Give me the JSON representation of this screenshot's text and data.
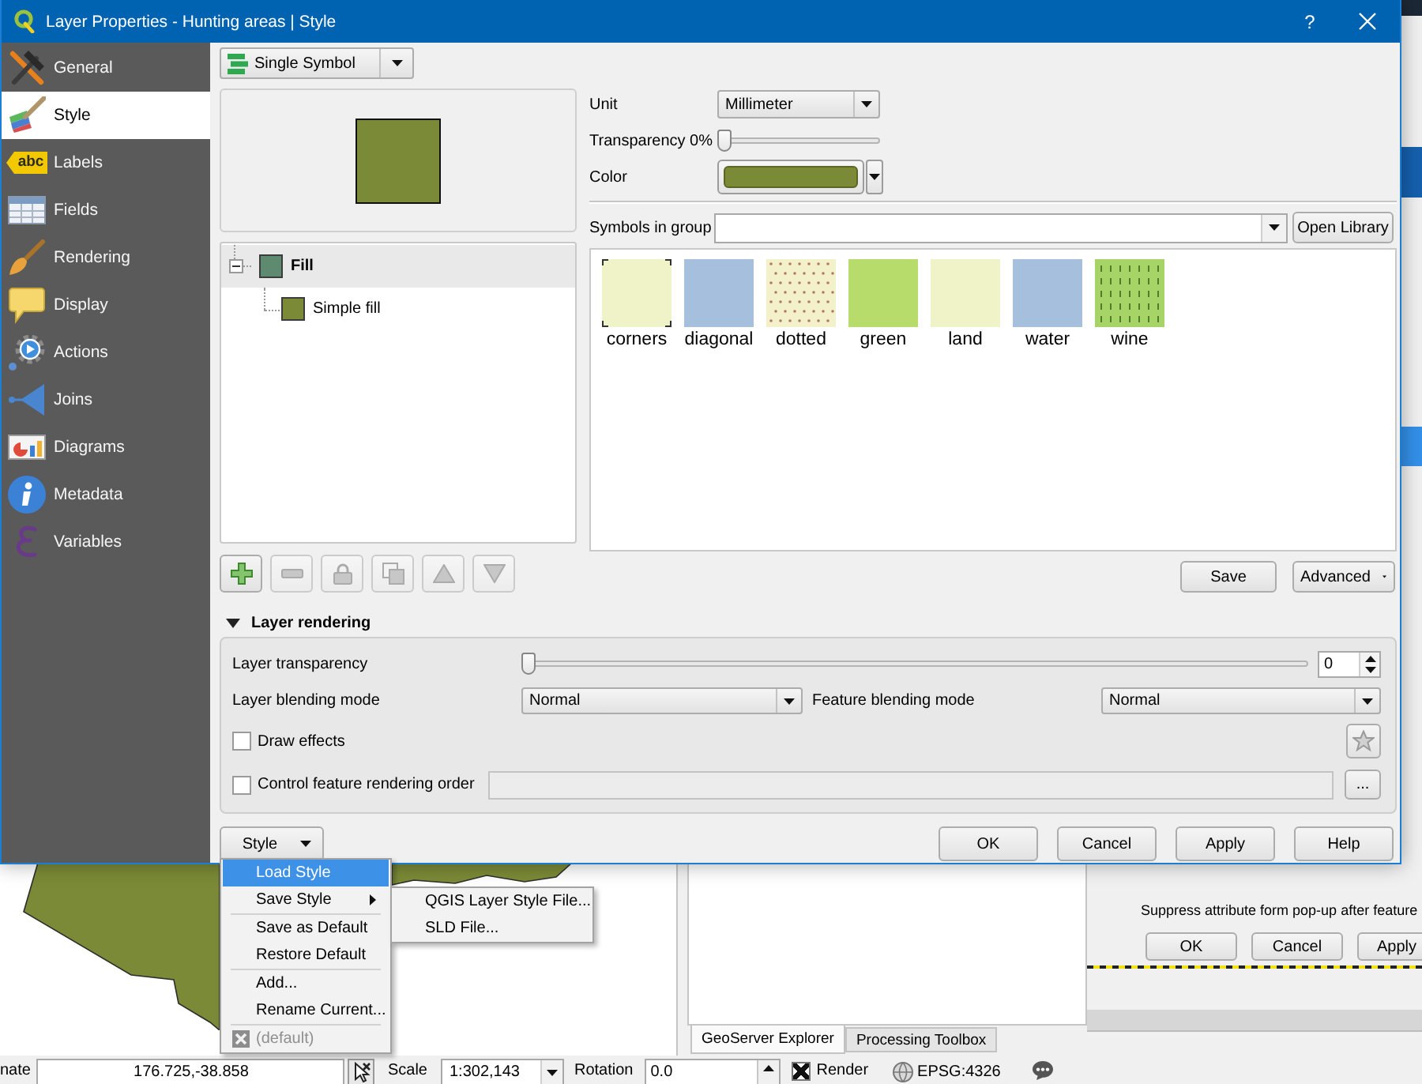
{
  "window": {
    "title": "Layer Properties - Hunting areas | Style",
    "help": "?"
  },
  "sidebar": {
    "items": [
      {
        "label": "General",
        "kind": "tools",
        "selected": false
      },
      {
        "label": "Style",
        "kind": "palette",
        "selected": true
      },
      {
        "label": "Labels",
        "kind": "tag",
        "tag_text": "abc",
        "selected": false
      },
      {
        "label": "Fields",
        "kind": "table",
        "selected": false
      },
      {
        "label": "Rendering",
        "kind": "paintbrush",
        "selected": false
      },
      {
        "label": "Display",
        "kind": "bubble",
        "selected": false
      },
      {
        "label": "Actions",
        "kind": "gear",
        "selected": false
      },
      {
        "label": "Joins",
        "kind": "cone",
        "selected": false
      },
      {
        "label": "Diagrams",
        "kind": "chart",
        "selected": false
      },
      {
        "label": "Metadata",
        "kind": "info",
        "selected": false
      },
      {
        "label": "Variables",
        "kind": "epsilon",
        "selected": false
      }
    ]
  },
  "renderer": {
    "value": "Single Symbol"
  },
  "symbol_layers": [
    {
      "label": "Fill",
      "color": "#5e8a70",
      "selected": true,
      "expanded": true,
      "children": [
        {
          "label": "Simple fill",
          "color": "#7b8a36",
          "selected": false
        }
      ]
    }
  ],
  "layer_buttons": [
    {
      "kind": "add",
      "disabled": false
    },
    {
      "kind": "remove",
      "disabled": true
    },
    {
      "kind": "lock",
      "disabled": true
    },
    {
      "kind": "duplicate",
      "disabled": true
    },
    {
      "kind": "up",
      "disabled": true
    },
    {
      "kind": "down",
      "disabled": true
    }
  ],
  "symbol_settings": {
    "unit_label": "Unit",
    "unit": "Millimeter",
    "transparency": {
      "label": "Transparency 0%",
      "level": 0
    },
    "color_label": "Color",
    "color": "#7b8a36"
  },
  "symbols_in_group": {
    "label": "Symbols in group",
    "open_library": "Open Library",
    "items": [
      {
        "label": "corners",
        "kind": "corners",
        "color": "#eff3c7",
        "selected": false
      },
      {
        "label": "diagonal",
        "kind": "plain",
        "color": "#a5bfdd",
        "selected": false
      },
      {
        "label": "dotted",
        "kind": "dotted",
        "color": "#f2f1c9",
        "selected": false
      },
      {
        "label": "green",
        "kind": "plain",
        "color": "#b7dc6b",
        "selected": false
      },
      {
        "label": "land",
        "kind": "plain",
        "color": "#eff3c7",
        "selected": false
      },
      {
        "label": "water",
        "kind": "plain",
        "color": "#a5bfdd",
        "selected": false
      },
      {
        "label": "wine",
        "kind": "dashed",
        "color": "#a6d466",
        "selected": false
      }
    ]
  },
  "symbol_actions": {
    "save": "Save",
    "advanced": "Advanced"
  },
  "layer_rendering": {
    "title": "Layer rendering",
    "expanded": true,
    "transparency": {
      "label": "Layer transparency",
      "level": 0,
      "value": "0"
    },
    "layer_blending_label": "Layer blending mode",
    "layer_blending": "Normal",
    "feature_blending_label": "Feature blending mode",
    "feature_blending": "Normal",
    "draw_effects": {
      "label": "Draw effects",
      "checked": false
    },
    "rendering_order": {
      "label": "Control feature rendering order",
      "checked": false
    },
    "order_button": "..."
  },
  "footer": {
    "style_button": "Style",
    "buttons": [
      "OK",
      "Cancel",
      "Apply",
      "Help"
    ]
  },
  "style_menu": {
    "groups": [
      [
        {
          "label": "Load Style",
          "kind": "action",
          "selected": true,
          "disabled": false
        },
        {
          "label": "Save Style",
          "kind": "submenu",
          "selected": false,
          "disabled": false
        }
      ],
      [
        {
          "label": "Save as Default",
          "kind": "action",
          "selected": false,
          "disabled": false
        },
        {
          "label": "Restore Default",
          "kind": "action",
          "selected": false,
          "disabled": false
        }
      ],
      [
        {
          "label": "Add...",
          "kind": "action",
          "selected": false,
          "disabled": false
        },
        {
          "label": "Rename Current...",
          "kind": "action",
          "selected": false,
          "disabled": false
        }
      ],
      [
        {
          "label": "(default)",
          "kind": "style",
          "selected": false,
          "disabled": true
        }
      ]
    ]
  },
  "save_style_submenu": {
    "items": [
      {
        "label": "QGIS Layer Style File...",
        "selected": false
      },
      {
        "label": "SLD File...",
        "selected": false
      }
    ]
  },
  "dock_tabs": [
    {
      "label": "GeoServer Explorer",
      "selected": true
    },
    {
      "label": "Processing Toolbox",
      "selected": false
    }
  ],
  "digitizing": {
    "text": "Suppress attribute form pop-up after feature",
    "buttons": [
      "OK",
      "Cancel",
      "Apply"
    ]
  },
  "status_bar": {
    "coordinate_label": "nate",
    "coordinate": "176.725,-38.858",
    "scale_label": "Scale",
    "scale": "1:302,143",
    "rotation_label": "Rotation",
    "rotation": "0.0",
    "render": {
      "label": "Render",
      "checked": true
    },
    "crs": "EPSG:4326"
  }
}
